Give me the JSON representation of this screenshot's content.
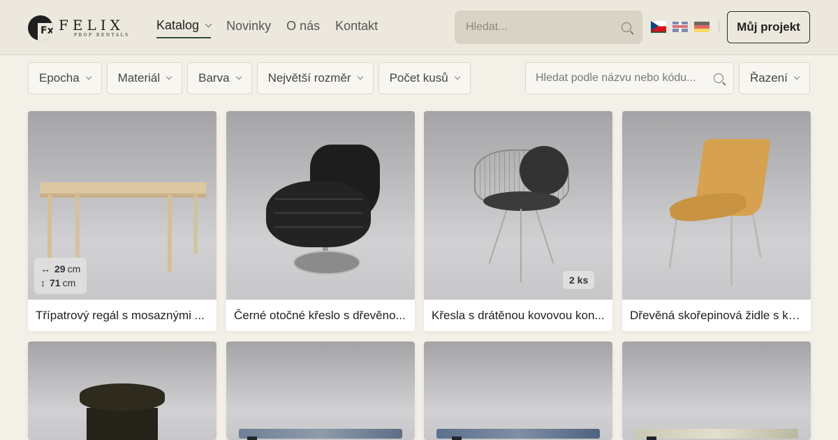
{
  "brand": {
    "logo_mark": "Fx",
    "name": "FELIX",
    "tagline": "PROP RENTALS"
  },
  "nav": {
    "items": [
      {
        "label": "Katalog",
        "has_dropdown": true,
        "active": true
      },
      {
        "label": "Novinky"
      },
      {
        "label": "O nás"
      },
      {
        "label": "Kontakt"
      }
    ]
  },
  "header_search": {
    "placeholder": "Hledat...",
    "icon": "search-icon"
  },
  "languages": [
    {
      "code": "cz",
      "active": true
    },
    {
      "code": "en"
    },
    {
      "code": "de"
    }
  ],
  "project_button": {
    "label": "Můj projekt"
  },
  "filters": [
    {
      "label": "Epocha"
    },
    {
      "label": "Materiál"
    },
    {
      "label": "Barva"
    },
    {
      "label": "Největší rozměr"
    },
    {
      "label": "Počet kusů"
    }
  ],
  "catalog_search": {
    "placeholder": "Hledat podle názvu nebo kódu..."
  },
  "sort": {
    "label": "Řazení"
  },
  "products": [
    {
      "title": "Třípatrový regál s mosaznými ...",
      "dims": {
        "width": "29",
        "height": "71",
        "unit": "cm"
      }
    },
    {
      "title": "Černé otočné křeslo s dřevěno..."
    },
    {
      "title": "Křesla s drátěnou kovovou kon...",
      "qty_badge": "2 ks"
    },
    {
      "title": "Dřevěná skořepinová židle s ko..."
    }
  ],
  "colors": {
    "background": "#f3f0e8",
    "header": "#ece8dd",
    "accent": "#2e4d40"
  }
}
